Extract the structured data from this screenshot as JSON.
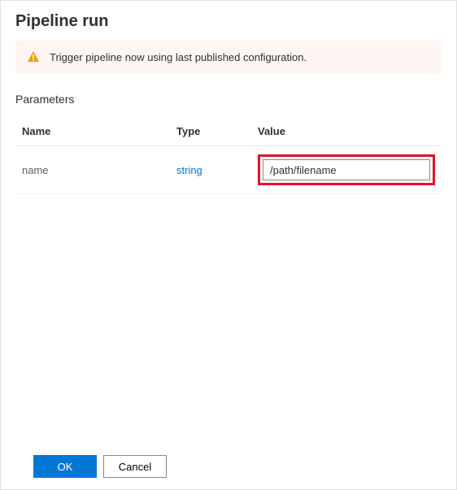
{
  "panel": {
    "title": "Pipeline run"
  },
  "info": {
    "icon": "warning-triangle",
    "message": "Trigger pipeline now using last published configuration."
  },
  "parameters": {
    "section_label": "Parameters",
    "columns": {
      "name": "Name",
      "type": "Type",
      "value": "Value"
    },
    "items": [
      {
        "name": "name",
        "type": "string",
        "value": "/path/filename"
      }
    ]
  },
  "footer": {
    "ok_label": "OK",
    "cancel_label": "Cancel"
  },
  "colors": {
    "primary": "#0078d4",
    "highlight": "#e3122a",
    "info_bg": "#fdf6f2",
    "warning_fill": "#eaa300",
    "warning_mark": "#ffffff"
  }
}
